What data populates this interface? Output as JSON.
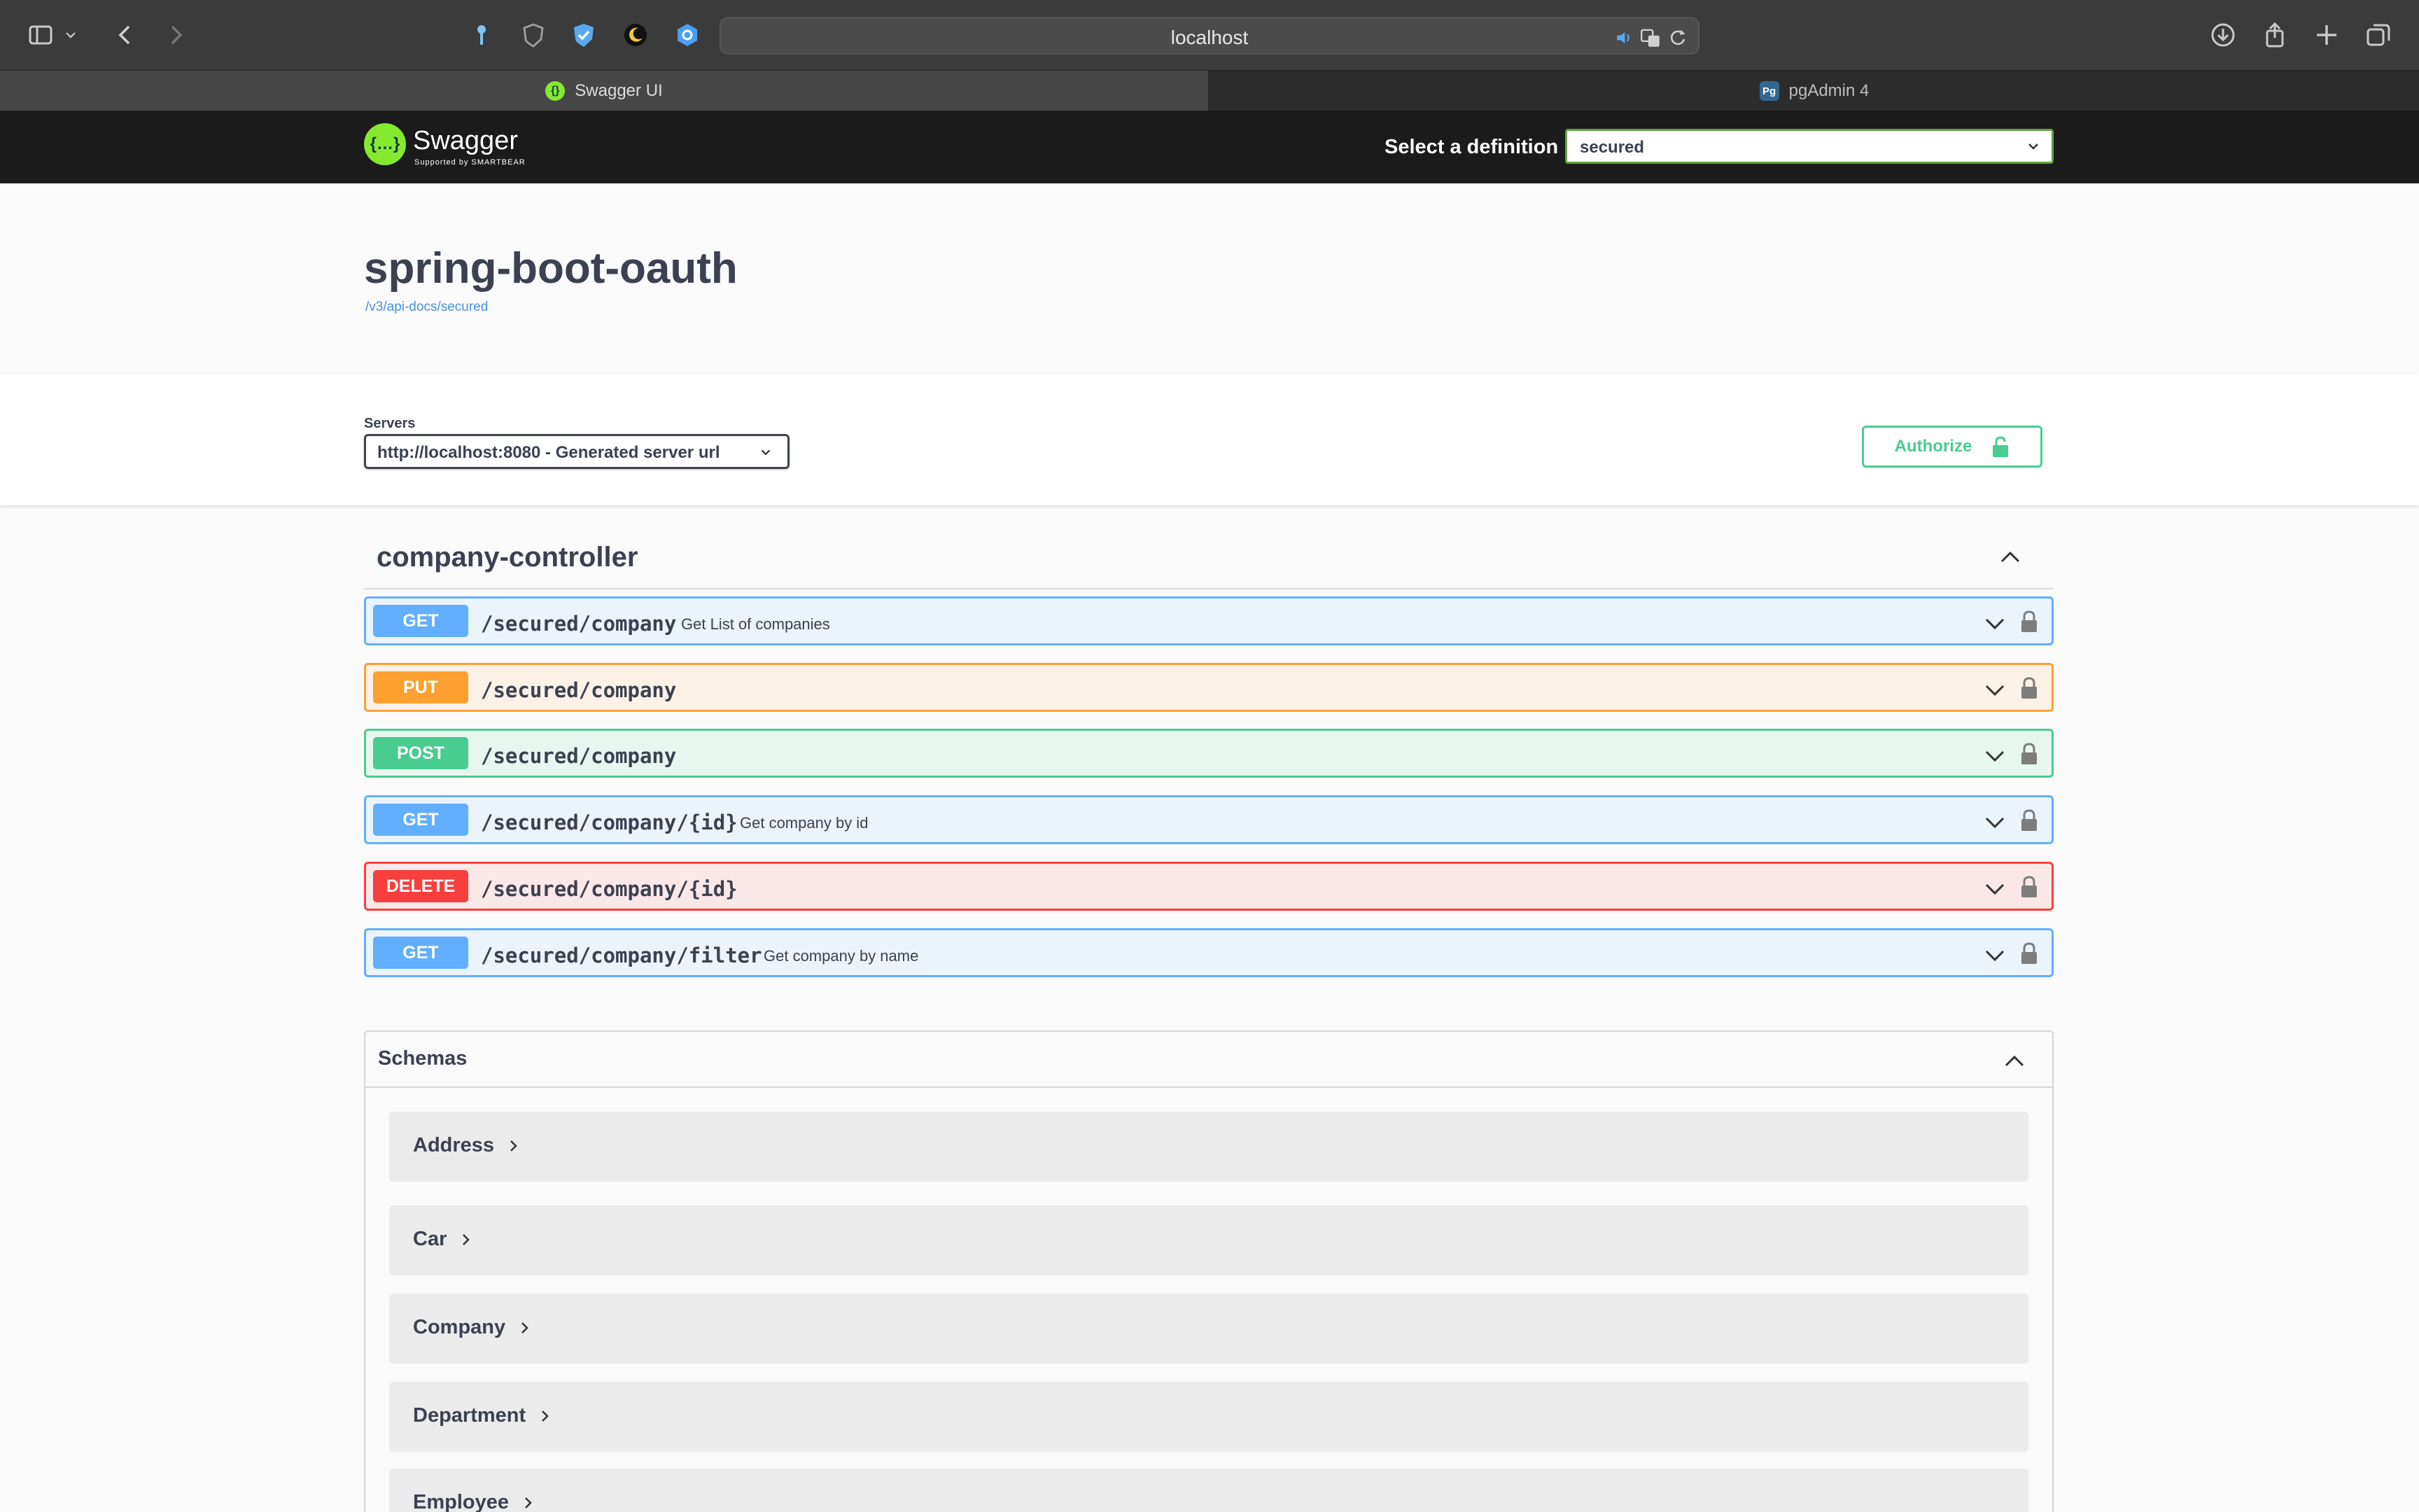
{
  "browser": {
    "url": "localhost",
    "tabs": [
      {
        "label": "Swagger UI",
        "icon": "swagger-favicon",
        "active": true
      },
      {
        "label": "pgAdmin 4",
        "icon": "pgadmin-favicon",
        "active": false
      }
    ]
  },
  "topbar": {
    "logo_text": "Swagger",
    "logo_sub": "Supported by SMARTBEAR",
    "definition_label": "Select a definition",
    "definition_value": "secured"
  },
  "info": {
    "title": "spring-boot-oauth",
    "spec_url": "/v3/api-docs/secured"
  },
  "servers": {
    "label": "Servers",
    "selected": "http://localhost:8080 - Generated server url",
    "authorize_label": "Authorize"
  },
  "controller": {
    "name": "company-controller",
    "operations": [
      {
        "method": "GET",
        "path": "/secured/company",
        "summary": "Get List of companies"
      },
      {
        "method": "PUT",
        "path": "/secured/company",
        "summary": ""
      },
      {
        "method": "POST",
        "path": "/secured/company",
        "summary": ""
      },
      {
        "method": "GET",
        "path": "/secured/company/{id}",
        "summary": "Get company by id"
      },
      {
        "method": "DELETE",
        "path": "/secured/company/{id}",
        "summary": ""
      },
      {
        "method": "GET",
        "path": "/secured/company/filter",
        "summary": "Get company by name"
      }
    ]
  },
  "schemas": {
    "title": "Schemas",
    "models": [
      "Address",
      "Car",
      "Company",
      "Department",
      "Employee"
    ]
  },
  "colors": {
    "get": "#61affe",
    "put": "#fca130",
    "post": "#49cc90",
    "delete": "#f93e3e",
    "swagger_green": "#85ea2d"
  }
}
